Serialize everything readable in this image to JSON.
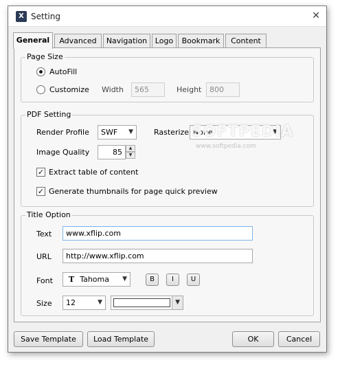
{
  "window": {
    "title": "Setting",
    "app_icon": "X"
  },
  "tabs": [
    {
      "label": "General",
      "active": true
    },
    {
      "label": "Advanced"
    },
    {
      "label": "Navigation"
    },
    {
      "label": "Logo"
    },
    {
      "label": "Bookmark"
    },
    {
      "label": "Content"
    }
  ],
  "page_size": {
    "group_title": "Page Size",
    "autofill_label": "AutoFill",
    "customize_label": "Customize",
    "width_label": "Width",
    "width_value": "565",
    "height_label": "Height",
    "height_value": "800",
    "selected": "AutoFill"
  },
  "pdf_setting": {
    "group_title": "PDF Setting",
    "render_profile_label": "Render Profile",
    "render_profile_value": "SWF",
    "rasterize_label": "Rasterize",
    "rasterize_value": "None",
    "image_quality_label": "Image Quality",
    "image_quality_value": "85",
    "extract_toc_label": "Extract table of content",
    "extract_toc_checked": true,
    "thumbnails_label": "Generate thumbnails for page quick preview",
    "thumbnails_checked": true
  },
  "title_option": {
    "group_title": "Title Option",
    "text_label": "Text",
    "text_value": "www.xflip.com",
    "url_label": "URL",
    "url_value": "http://www.xflip.com",
    "font_label": "Font",
    "font_value": "Tahoma",
    "font_glyph": "T",
    "bold_label": "B",
    "italic_label": "I",
    "underline_label": "U",
    "size_label": "Size",
    "size_value": "12",
    "color_value": ""
  },
  "footer": {
    "save_template": "Save  Template",
    "load_template": "Load  Template",
    "ok": "OK",
    "cancel": "Cancel"
  },
  "watermark": {
    "main": "SOFTPEDIA",
    "sub": "www.softpedia.com"
  },
  "icons": {
    "close": "close-icon",
    "app": "app-icon",
    "dropdown": "chevron-down-icon",
    "font_type": "font-type-icon"
  }
}
